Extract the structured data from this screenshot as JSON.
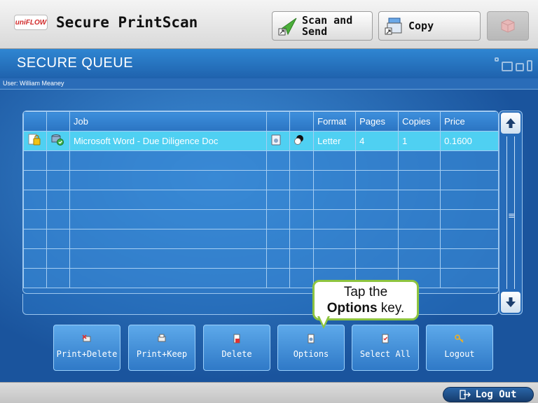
{
  "topbar": {
    "logo_text": "uniFLOW",
    "app_title": "Secure PrintScan",
    "scan_label_1": "Scan and",
    "scan_label_2": "Send",
    "copy_label": "Copy"
  },
  "queue": {
    "title": "SECURE QUEUE",
    "user": "User: William Meaney"
  },
  "table": {
    "headers": {
      "job": "Job",
      "format": "Format",
      "pages": "Pages",
      "copies": "Copies",
      "price": "Price"
    },
    "rows": [
      {
        "job": "Microsoft Word - Due Diligence Doc",
        "format": "Letter",
        "pages": "4",
        "copies": "1",
        "price": "0.1600"
      }
    ]
  },
  "callout": {
    "line1": "Tap the",
    "bold": "Options",
    "rest": " key."
  },
  "actions": {
    "print_delete": "Print+Delete",
    "print_keep": "Print+Keep",
    "delete": "Delete",
    "options": "Options",
    "select_all": "Select All",
    "logout": "Logout"
  },
  "footer": {
    "logout_label": "Log Out"
  },
  "colors": {
    "accent": "#2f79c7",
    "selected_row": "#4fd0f2",
    "callout_border": "#8dc43f"
  }
}
